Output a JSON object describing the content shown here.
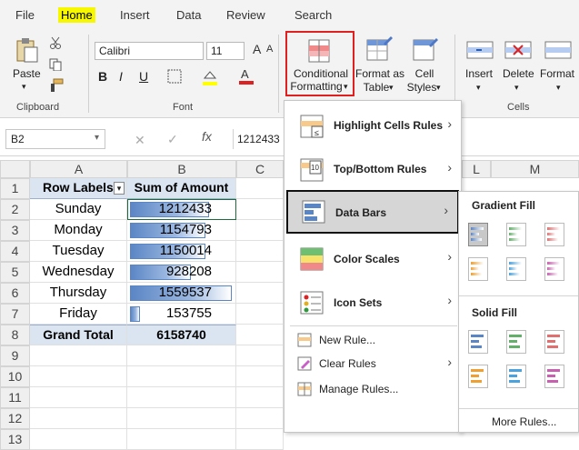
{
  "tabs": {
    "file": "File",
    "home": "Home",
    "insert": "Insert",
    "data": "Data",
    "review": "Review",
    "search": "Search"
  },
  "ribbon": {
    "paste": "Paste",
    "clipboard_group": "Clipboard",
    "font_name": "Calibri",
    "font_size": "11",
    "font_group": "Font",
    "bold": "B",
    "italic": "I",
    "underline": "U",
    "conditional_formatting": "Conditional",
    "conditional_formatting_2": "Formatting",
    "format_as_table": "Format as",
    "format_as_table_2": "Table",
    "cell_styles": "Cell",
    "cell_styles_2": "Styles",
    "insert": "Insert",
    "delete": "Delete",
    "format": "Format",
    "cells_group": "Cells"
  },
  "formula_bar": {
    "name_box": "B2",
    "fx": "fx",
    "value": "1212433"
  },
  "columns": [
    "A",
    "B",
    "C",
    "L",
    "M"
  ],
  "rows": [
    "1",
    "2",
    "3",
    "4",
    "5",
    "6",
    "7",
    "8",
    "9",
    "10",
    "11",
    "12",
    "13"
  ],
  "pivot": {
    "header_a": "Row Labels",
    "header_b": "Sum of Amount",
    "rows": [
      {
        "label": "Sunday",
        "value": "1212433",
        "fill": 0.78
      },
      {
        "label": "Monday",
        "value": "1154793",
        "fill": 0.74
      },
      {
        "label": "Tuesday",
        "value": "1150014",
        "fill": 0.74
      },
      {
        "label": "Wednesday",
        "value": "928208",
        "fill": 0.6
      },
      {
        "label": "Thursday",
        "value": "1559537",
        "fill": 1.0
      },
      {
        "label": "Friday",
        "value": "153755",
        "fill": 0.1
      }
    ],
    "total_label": "Grand Total",
    "total_value": "6158740"
  },
  "menu": {
    "highlight": "Highlight Cells Rules",
    "topbottom": "Top/Bottom Rules",
    "databars": "Data Bars",
    "colorscales": "Color Scales",
    "iconsets": "Icon Sets",
    "newrule": "New Rule...",
    "clearrules": "Clear Rules",
    "managerules": "Manage Rules..."
  },
  "submenu": {
    "gradient": "Gradient Fill",
    "solid": "Solid Fill",
    "more": "More Rules..."
  },
  "colors": {
    "accent_red": "#e02020",
    "bar_blue": "#5b86c5",
    "pivot_header": "#dbe5f1",
    "highlight_yellow": "#f7f700"
  }
}
